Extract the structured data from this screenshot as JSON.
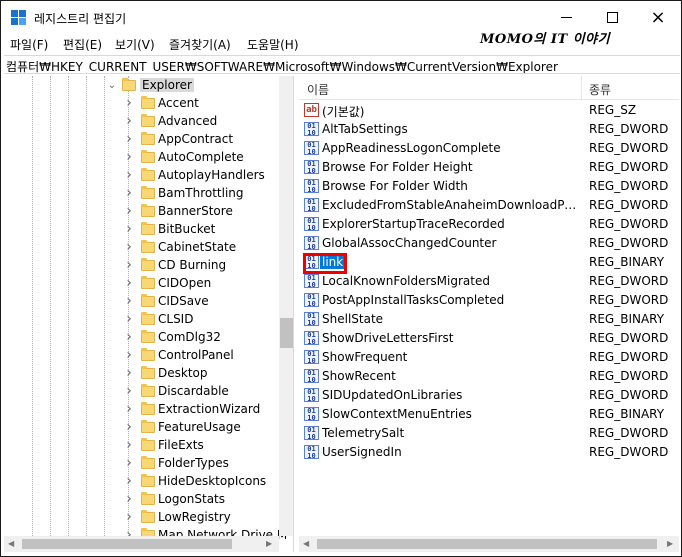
{
  "window": {
    "title": "레지스트리 편집기",
    "icon": "registry-editor-icon",
    "controls": {
      "minimize": "minimize-icon",
      "maximize": "maximize-icon",
      "close": "×"
    }
  },
  "watermark": "MOMO의 IT 이야기",
  "menu": [
    "파일(F)",
    "편집(E)",
    "보기(V)",
    "즐겨찾기(A)",
    "도움말(H)"
  ],
  "address": "컴퓨터₩HKEY_CURRENT_USER₩SOFTWARE₩Microsoft₩Windows₩CurrentVersion₩Explorer",
  "tree": {
    "selected": "Explorer",
    "items": [
      "Accent",
      "Advanced",
      "AppContract",
      "AutoComplete",
      "AutoplayHandlers",
      "BamThrottling",
      "BannerStore",
      "BitBucket",
      "CabinetState",
      "CD Burning",
      "CIDOpen",
      "CIDSave",
      "CLSID",
      "ComDlg32",
      "ControlPanel",
      "Desktop",
      "Discardable",
      "ExtractionWizard",
      "FeatureUsage",
      "FileExts",
      "FolderTypes",
      "HideDesktopIcons",
      "LogonStats",
      "LowRegistry",
      "Map Network Drive M"
    ]
  },
  "list": {
    "columns": {
      "name": "이름",
      "type": "종류"
    },
    "rows": [
      {
        "name": "(기본값)",
        "type": "REG_SZ",
        "icon": "string-value-icon"
      },
      {
        "name": "AltTabSettings",
        "type": "REG_DWORD",
        "icon": "binary-value-icon"
      },
      {
        "name": "AppReadinessLogonComplete",
        "type": "REG_DWORD",
        "icon": "binary-value-icon"
      },
      {
        "name": "Browse For Folder Height",
        "type": "REG_DWORD",
        "icon": "binary-value-icon"
      },
      {
        "name": "Browse For Folder Width",
        "type": "REG_DWORD",
        "icon": "binary-value-icon"
      },
      {
        "name": "ExcludedFromStableAnaheimDownloadPromo...",
        "type": "REG_DWORD",
        "icon": "binary-value-icon"
      },
      {
        "name": "ExplorerStartupTraceRecorded",
        "type": "REG_DWORD",
        "icon": "binary-value-icon"
      },
      {
        "name": "GlobalAssocChangedCounter",
        "type": "REG_DWORD",
        "icon": "binary-value-icon"
      },
      {
        "name": "link",
        "type": "REG_BINARY",
        "icon": "binary-value-icon"
      },
      {
        "name": "LocalKnownFoldersMigrated",
        "type": "REG_DWORD",
        "icon": "binary-value-icon"
      },
      {
        "name": "PostAppInstallTasksCompleted",
        "type": "REG_DWORD",
        "icon": "binary-value-icon"
      },
      {
        "name": "ShellState",
        "type": "REG_BINARY",
        "icon": "binary-value-icon"
      },
      {
        "name": "ShowDriveLettersFirst",
        "type": "REG_DWORD",
        "icon": "binary-value-icon"
      },
      {
        "name": "ShowFrequent",
        "type": "REG_DWORD",
        "icon": "binary-value-icon"
      },
      {
        "name": "ShowRecent",
        "type": "REG_DWORD",
        "icon": "binary-value-icon"
      },
      {
        "name": "SIDUpdatedOnLibraries",
        "type": "REG_DWORD",
        "icon": "binary-value-icon"
      },
      {
        "name": "SlowContextMenuEntries",
        "type": "REG_BINARY",
        "icon": "binary-value-icon"
      },
      {
        "name": "TelemetrySalt",
        "type": "REG_DWORD",
        "icon": "binary-value-icon"
      },
      {
        "name": "UserSignedIn",
        "type": "REG_DWORD",
        "icon": "binary-value-icon"
      }
    ],
    "selected": "link"
  },
  "colors": {
    "selection": "#0078d7",
    "highlight_box": "#e00000",
    "folder": "#f8d775"
  }
}
